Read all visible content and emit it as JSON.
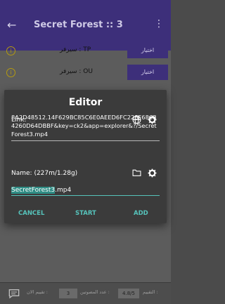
{
  "appbar": {
    "back_icon": "arrow-left-icon",
    "title": "Secret Forest :: 3",
    "more_icon": "more-vert-icon"
  },
  "servers": [
    {
      "label": "سيرفر : TP",
      "button": "اختيار"
    },
    {
      "label": "سيرفر : OU",
      "button": "اختيار"
    }
  ],
  "dialog": {
    "title": "Editor",
    "link_label": "Link:",
    "link_value": "8A2D48512.14F629BC85C6E0AEED6FC228F68684260D64DBBF&key=ck2&app=explorer&?/SecretForest3.mp4",
    "name_label": "Name: (227m/1.28g)",
    "name_selected": "SecretForest3",
    "name_rest": ".mp4",
    "cancel": "CANCEL",
    "start": "START",
    "add": "ADD"
  },
  "bottombar": {
    "chat_icon": "chat-icon",
    "rating_value": "4.8/5",
    "rating_label": "التقييم :",
    "votes_label": "عدد المصوتين :",
    "votes_value": "3",
    "your_rating_label": "تقييم الان :"
  }
}
